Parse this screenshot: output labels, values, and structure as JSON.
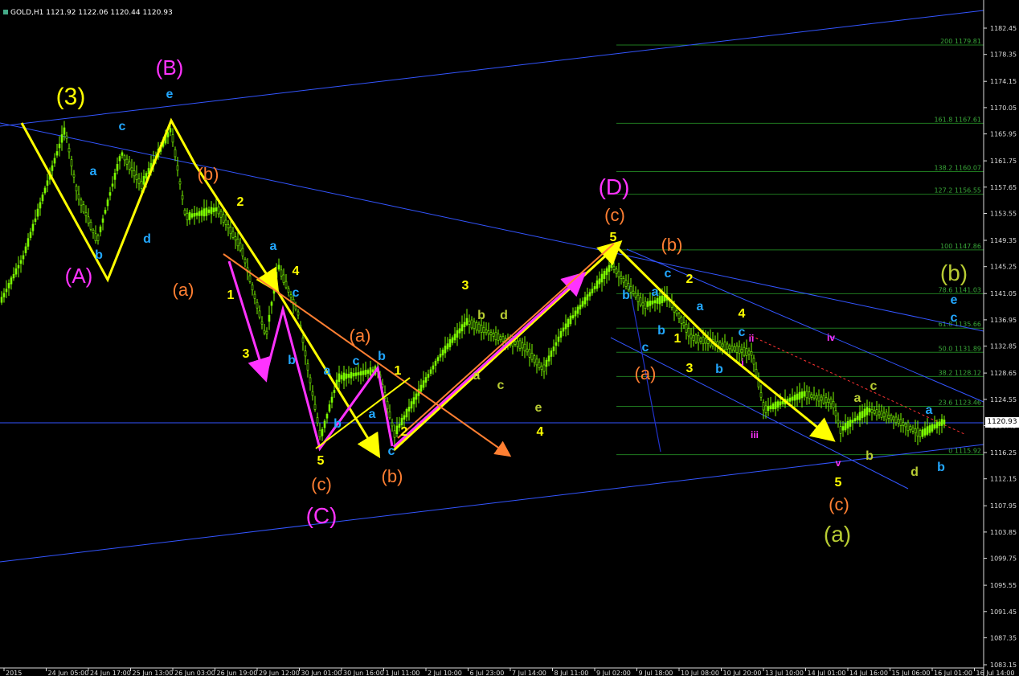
{
  "header": {
    "symbol_info": "GOLD,H1  1121.92 1122.06 1120.44 1120.93"
  },
  "colors": {
    "background": "#000000",
    "candles": "#7CFC00",
    "trendline": "#3355ff",
    "yellow": "#ffff00",
    "magenta": "#ff33ff",
    "orange": "#ff7f32",
    "cyan": "#22a7ff",
    "olive": "#b8cc33",
    "fib": "#1f7a1f"
  },
  "chart_data": {
    "type": "candlestick",
    "symbol": "GOLD",
    "timeframe": "H1",
    "last_price": "1120.93",
    "ylim": [
      1083.15,
      1184.55
    ],
    "y_ticks": [
      "1182.45",
      "1178.35",
      "1174.15",
      "1170.05",
      "1165.95",
      "1161.75",
      "1157.65",
      "1153.55",
      "1149.35",
      "1145.25",
      "1141.05",
      "1136.95",
      "1132.85",
      "1128.65",
      "1124.55",
      "1120.45",
      "1116.25",
      "1112.15",
      "1107.95",
      "1103.85",
      "1099.75",
      "1095.55",
      "1091.45",
      "1087.35",
      "1083.15"
    ],
    "fib_levels": [
      {
        "label": "200",
        "value": 1179.81
      },
      {
        "label": "161.8",
        "value": 1167.61
      },
      {
        "label": "138.2",
        "value": 1160.07
      },
      {
        "label": "127.2",
        "value": 1156.55
      },
      {
        "label": "100",
        "value": 1147.86
      },
      {
        "label": "78.6",
        "value": 1141.03
      },
      {
        "label": "61.8",
        "value": 1135.66
      },
      {
        "label": "50.0",
        "value": 1131.89
      },
      {
        "label": "38.2",
        "value": 1128.12
      },
      {
        "label": "23.6",
        "value": 1123.46
      },
      {
        "label": "0",
        "value": 1115.92
      }
    ],
    "x_axis_labels": [
      "2015",
      "24 Jun 05:00",
      "24 Jun 17:00",
      "25 Jun 13:00",
      "26 Jun 03:00",
      "26 Jun 19:00",
      "29 Jun 12:00",
      "30 Jun 01:00",
      "30 Jun 16:00",
      "1 Jul 11:00",
      "2 Jul 10:00",
      "6 Jul 23:00",
      "7 Jul 14:00",
      "8 Jul 11:00",
      "9 Jul 02:00",
      "9 Jul 18:00",
      "10 Jul 08:00",
      "10 Jul 20:00",
      "13 Jul 10:00",
      "14 Jul 01:00",
      "14 Jul 16:00",
      "15 Jul 06:00",
      "16 Jul 01:00",
      "16 Jul 14:00"
    ],
    "wave_labels": [
      {
        "text": "(3)",
        "color": "yellow"
      },
      {
        "text": "(B)",
        "color": "magenta"
      },
      {
        "text": "e",
        "color": "cyan"
      },
      {
        "text": "c",
        "color": "cyan"
      },
      {
        "text": "a",
        "color": "cyan"
      },
      {
        "text": "d",
        "color": "cyan"
      },
      {
        "text": "b",
        "color": "cyan"
      },
      {
        "text": "(A)",
        "color": "magenta"
      },
      {
        "text": "(b)",
        "color": "orange"
      },
      {
        "text": "2",
        "color": "yellow"
      },
      {
        "text": "(a)",
        "color": "orange"
      },
      {
        "text": "1",
        "color": "yellow"
      },
      {
        "text": "a",
        "color": "cyan"
      },
      {
        "text": "4",
        "color": "yellow"
      },
      {
        "text": "c",
        "color": "cyan"
      },
      {
        "text": "3",
        "color": "yellow"
      },
      {
        "text": "b",
        "color": "cyan"
      },
      {
        "text": "(a)",
        "color": "orange"
      },
      {
        "text": "c",
        "color": "cyan"
      },
      {
        "text": "a",
        "color": "cyan"
      },
      {
        "text": "b",
        "color": "cyan"
      },
      {
        "text": "1",
        "color": "yellow"
      },
      {
        "text": "a",
        "color": "cyan"
      },
      {
        "text": "b",
        "color": "cyan"
      },
      {
        "text": "c",
        "color": "cyan"
      },
      {
        "text": "5",
        "color": "yellow"
      },
      {
        "text": "2",
        "color": "yellow"
      },
      {
        "text": "(b)",
        "color": "orange"
      },
      {
        "text": "(c)",
        "color": "orange"
      },
      {
        "text": "(C)",
        "color": "magenta"
      },
      {
        "text": "3",
        "color": "yellow"
      },
      {
        "text": "b",
        "color": "olive"
      },
      {
        "text": "d",
        "color": "olive"
      },
      {
        "text": "a",
        "color": "olive"
      },
      {
        "text": "c",
        "color": "olive"
      },
      {
        "text": "e",
        "color": "olive"
      },
      {
        "text": "4",
        "color": "yellow"
      },
      {
        "text": "(D)",
        "color": "magenta"
      },
      {
        "text": "(c)",
        "color": "orange"
      },
      {
        "text": "5",
        "color": "yellow"
      },
      {
        "text": "(b)",
        "color": "orange"
      },
      {
        "text": "b",
        "color": "cyan"
      },
      {
        "text": "c",
        "color": "cyan"
      },
      {
        "text": "a",
        "color": "cyan"
      },
      {
        "text": "2",
        "color": "yellow"
      },
      {
        "text": "a",
        "color": "cyan"
      },
      {
        "text": "b",
        "color": "cyan"
      },
      {
        "text": "1",
        "color": "yellow"
      },
      {
        "text": "c",
        "color": "cyan"
      },
      {
        "text": "(a)",
        "color": "orange"
      },
      {
        "text": "3",
        "color": "yellow"
      },
      {
        "text": "b",
        "color": "cyan"
      },
      {
        "text": "4",
        "color": "yellow"
      },
      {
        "text": "c",
        "color": "cyan"
      },
      {
        "text": "ii",
        "color": "magenta"
      },
      {
        "text": "i",
        "color": "magenta"
      },
      {
        "text": "iii",
        "color": "magenta"
      },
      {
        "text": "iv",
        "color": "magenta"
      },
      {
        "text": "a",
        "color": "olive"
      },
      {
        "text": "c",
        "color": "olive"
      },
      {
        "text": "b",
        "color": "olive"
      },
      {
        "text": "v",
        "color": "magenta"
      },
      {
        "text": "5",
        "color": "yellow"
      },
      {
        "text": "(c)",
        "color": "orange"
      },
      {
        "text": "(a)",
        "color": "olive"
      },
      {
        "text": "d",
        "color": "olive"
      },
      {
        "text": "(b)",
        "color": "olive"
      },
      {
        "text": "e",
        "color": "cyan"
      },
      {
        "text": "c",
        "color": "cyan"
      },
      {
        "text": "a",
        "color": "cyan"
      },
      {
        "text": "b",
        "color": "cyan"
      }
    ]
  }
}
